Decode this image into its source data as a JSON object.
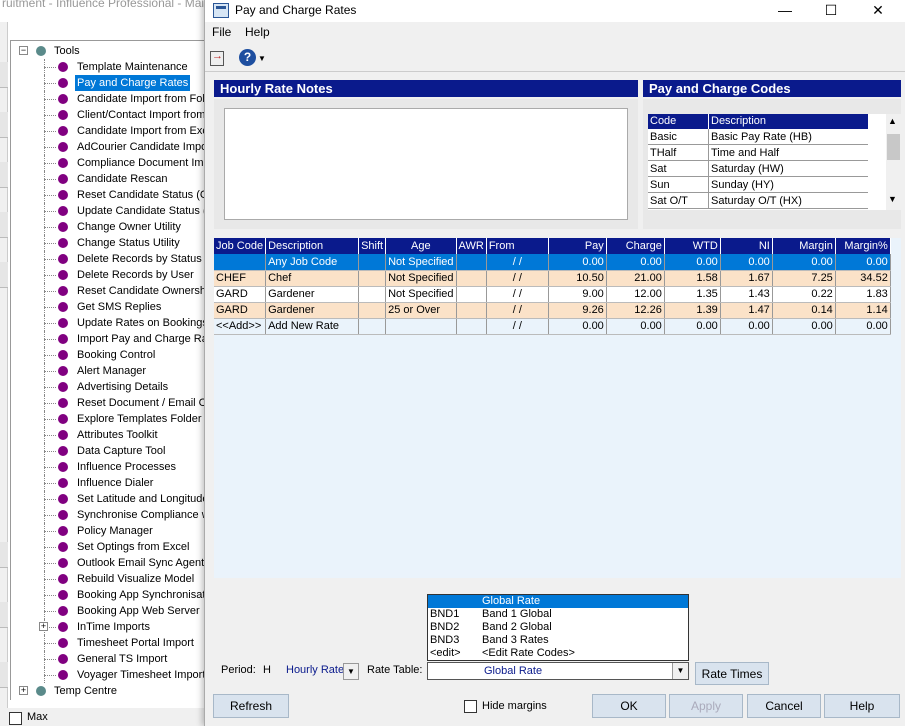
{
  "background_app": {
    "title": "ruitment - Influence Professional - Mai",
    "tree": {
      "root_label": "Tools",
      "items": [
        "Template Maintenance",
        "Pay and Charge Rates",
        "Candidate Import from Folde",
        "Client/Contact Import from E",
        "Candidate Import from Exce",
        "AdCourier Candidate Impor",
        "Compliance Document Impo",
        "Candidate Rescan",
        "Reset Candidate Status (Co",
        "Update Candidate Status (E",
        "Change Owner Utility",
        "Change Status Utility",
        "Delete Records by Status",
        "Delete Records by User",
        "Reset Candidate Ownership",
        "Get SMS Replies",
        "Update Rates on Bookings",
        "Import Pay and Charge Rate",
        "Booking Control",
        "Alert Manager",
        "Advertising Details",
        "Reset Document / Email Co",
        "Explore Templates Folder",
        "Attributes Toolkit",
        "Data Capture Tool",
        "Influence Processes",
        "Influence Dialer",
        "Set Latitude and Longitudes",
        "Synchronise Compliance w",
        "Policy Manager",
        "Set Optings from Excel",
        "Outlook Email Sync Agent",
        "Rebuild Visualize Model",
        "Booking App Synchronisatio",
        "Booking App Web Server",
        "InTime Imports",
        "Timesheet Portal Import",
        "General TS Import",
        "Voyager Timesheet Import"
      ],
      "selected_index": 1,
      "next_root_label": "Temp Centre"
    },
    "bottom_checkbox_label": "Max"
  },
  "dialog": {
    "title": "Pay and Charge Rates",
    "window_buttons": {
      "minimize": "—",
      "maximize": "☐",
      "close": "✕"
    },
    "menu": [
      "File",
      "Help"
    ],
    "notes_header": "Hourly Rate Notes",
    "codes_header": "Pay and Charge Codes",
    "codes_columns": [
      "Code",
      "Description"
    ],
    "codes_rows": [
      [
        "Basic",
        "Basic Pay Rate (HB)"
      ],
      [
        "THalf",
        "Time and Half"
      ],
      [
        "Sat",
        "Saturday (HW)"
      ],
      [
        "Sun",
        "Sunday (HY)"
      ],
      [
        "Sat O/T",
        "Saturday O/T (HX)"
      ]
    ],
    "rates_columns": [
      "Job Code",
      "Description",
      "Shift",
      "Age",
      "AWR",
      "From",
      "Pay",
      "Charge",
      "WTD",
      "NI",
      "Margin",
      "Margin%"
    ],
    "rates_rows": [
      [
        "",
        "Any Job Code",
        "",
        "Not Specified",
        "",
        "/   /",
        "0.00",
        "0.00",
        "0.00",
        "0.00",
        "0.00",
        "0.00"
      ],
      [
        "CHEF",
        "Chef",
        "",
        "Not Specified",
        "",
        "/   /",
        "10.50",
        "21.00",
        "1.58",
        "1.67",
        "7.25",
        "34.52"
      ],
      [
        "GARD",
        "Gardener",
        "",
        "Not Specified",
        "",
        "/   /",
        "9.00",
        "12.00",
        "1.35",
        "1.43",
        "0.22",
        "1.83"
      ],
      [
        "GARD",
        "Gardener",
        "",
        "25 or Over",
        "",
        "/   /",
        "9.26",
        "12.26",
        "1.39",
        "1.47",
        "0.14",
        "1.14"
      ],
      [
        "<<Add>>",
        "Add New Rate",
        "",
        "",
        "",
        "/   /",
        "0.00",
        "0.00",
        "0.00",
        "0.00",
        "0.00",
        "0.00"
      ]
    ],
    "rate_table_dropdown": [
      [
        "",
        "Global Rate"
      ],
      [
        "BND1",
        "Band 1 Global"
      ],
      [
        "BND2",
        "Band 2 Global"
      ],
      [
        "BND3",
        "Band 3 Rates"
      ],
      [
        "<edit>",
        "<Edit Rate Codes>"
      ]
    ],
    "period_label": "Period:",
    "period_code": "H",
    "period_value": "Hourly Rate",
    "rate_table_label": "Rate Table:",
    "rate_table_value": "Global Rate",
    "rate_times_button": "Rate Times",
    "buttons": {
      "refresh": "Refresh",
      "hide_margins": "Hide margins",
      "ok": "OK",
      "apply": "Apply",
      "cancel": "Cancel",
      "help": "Help"
    }
  }
}
